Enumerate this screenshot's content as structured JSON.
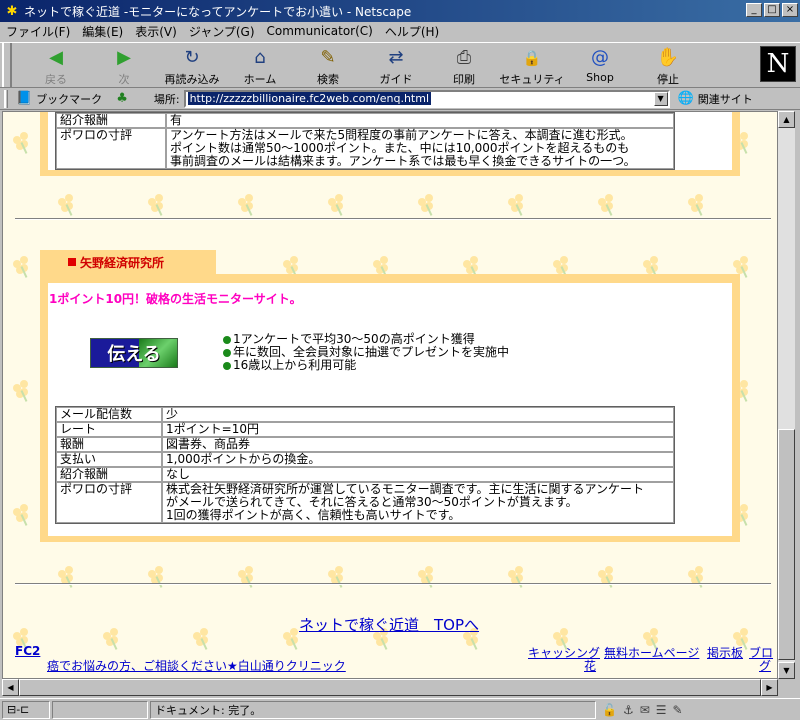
{
  "window": {
    "title": "ネットで稼ぐ近道 -モニターになってアンケートでお小遣い - Netscape",
    "controls": {
      "minimize": "_",
      "maximize": "□",
      "close": "×"
    }
  },
  "menu": [
    "ファイル(F)",
    "編集(E)",
    "表示(V)",
    "ジャンプ(G)",
    "Communicator(C)",
    "ヘルプ(H)"
  ],
  "toolbar": {
    "buttons": [
      {
        "label": "戻る",
        "icon": "back-arrow-icon",
        "glyph": "◀"
      },
      {
        "label": "次",
        "icon": "forward-arrow-icon",
        "glyph": "▶"
      },
      {
        "label": "再読み込み",
        "icon": "reload-icon",
        "glyph": "↻"
      },
      {
        "label": "ホーム",
        "icon": "home-icon",
        "glyph": "⌂"
      },
      {
        "label": "検索",
        "icon": "search-icon",
        "glyph": "✎"
      },
      {
        "label": "ガイド",
        "icon": "guide-icon",
        "glyph": "⇄"
      },
      {
        "label": "印刷",
        "icon": "print-icon",
        "glyph": "⎙"
      },
      {
        "label": "セキュリティ",
        "icon": "lock-icon",
        "glyph": "🔒"
      },
      {
        "label": "Shop",
        "icon": "shop-icon",
        "glyph": "@"
      },
      {
        "label": "停止",
        "icon": "stop-icon",
        "glyph": "✋"
      }
    ],
    "logo": "N"
  },
  "location": {
    "bookmarks_label": "ブックマーク",
    "location_label": "場所:",
    "url": "http://zzzzzbillionaire.fc2web.com/enq.html",
    "related_label": "関連サイト"
  },
  "section1": {
    "rows": [
      {
        "label": "紹介報酬",
        "value": "有"
      },
      {
        "label": "ポワロの寸評",
        "value": "アンケート方法はメールで来た5問程度の事前アンケートに答え、本調査に進む形式。\nポイント数は通常50～1000ポイント。また、中には10,000ポイントを超えるものも\n事前調査のメールは結構来ます。アンケート系では最も早く換金できるサイトの一つ。"
      }
    ]
  },
  "section2": {
    "tab_title": "矢野経済研究所",
    "catchphrase": "1ポイント10円！破格の生活モニターサイト。",
    "banner_text": "伝える",
    "bullets": [
      "1アンケートで平均30～50の高ポイント獲得",
      "年に数回、全会員対象に抽選でプレゼントを実施中",
      "16歳以上から利用可能"
    ],
    "rows": [
      {
        "label": "メール配信数",
        "value": "少"
      },
      {
        "label": "レート",
        "value": "1ポイント=10円"
      },
      {
        "label": "報酬",
        "value": "図書券、商品券"
      },
      {
        "label": "支払い",
        "value": "1,000ポイントからの換金。"
      },
      {
        "label": "紹介報酬",
        "value": "なし"
      },
      {
        "label": "ポワロの寸評",
        "value": "株式会社矢野経済研究所が運営しているモニター調査です。主に生活に関するアンケート\nがメールで送られてきて、それに答えると通常30～50ポイントが貰えます。\n1回の獲得ポイントが高く、信頼性も高いサイトです。"
      }
    ]
  },
  "footer": {
    "top_link": "ネットで稼ぐ近道　TOPへ",
    "fc2": "FC2",
    "ad_link": "癌でお悩みの方、ご相談ください★白山通りクリニック",
    "links": [
      "キャッシング",
      "花",
      "無料ホームページ",
      "掲示板",
      "ブロ",
      "グ"
    ]
  },
  "status": {
    "text": "ドキュメント: 完了。"
  }
}
